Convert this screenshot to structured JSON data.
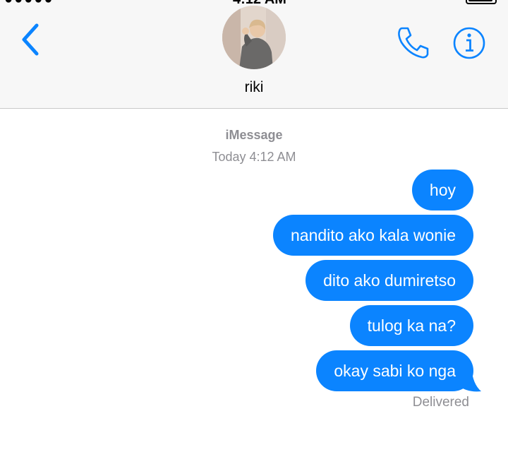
{
  "header": {
    "contact_name": "riki",
    "back_icon": "chevron-left-icon",
    "phone_icon": "phone-icon",
    "info_icon": "info-icon",
    "accent_color": "#0b84ff"
  },
  "thread": {
    "service": "iMessage",
    "timestamp": "Today 4:12 AM",
    "messages": [
      {
        "text": "hoy"
      },
      {
        "text": "nandito ako kala wonie"
      },
      {
        "text": "dito ako dumiretso"
      },
      {
        "text": "tulog ka na?"
      },
      {
        "text": "okay sabi ko nga"
      }
    ],
    "status": "Delivered"
  }
}
